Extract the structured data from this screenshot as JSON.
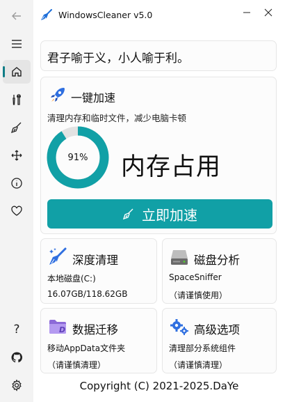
{
  "app": {
    "title": "WindowsCleaner v5.0",
    "accent": "#11a0a6"
  },
  "sidebar": {
    "top_items": [
      {
        "icon": "back-arrow-icon"
      },
      {
        "icon": "hamburger-menu-icon"
      }
    ],
    "items": [
      {
        "icon": "home-icon",
        "active": true
      },
      {
        "icon": "tools-icon"
      },
      {
        "icon": "broom-icon"
      },
      {
        "icon": "move-arrows-icon"
      },
      {
        "icon": "info-icon"
      },
      {
        "icon": "heart-icon"
      }
    ],
    "bottom_items": [
      {
        "icon": "help-icon",
        "label": "?"
      },
      {
        "icon": "github-icon"
      },
      {
        "icon": "settings-gear-icon"
      }
    ]
  },
  "window_controls": {
    "minimize": "minimize-icon",
    "close": "close-icon"
  },
  "quote": "君子喻于义，小人喻于利。",
  "boost": {
    "title": "一键加速",
    "description": "清理内存和临时文件，减少电脑卡顿",
    "memory_percent_value": 91,
    "memory_percent_text": "91%",
    "memory_label": "内存占用",
    "button_label": "立即加速",
    "ring_color": "#11a0a6",
    "ring_track": "#e2e2e2"
  },
  "tiles": [
    {
      "title": "深度清理",
      "line1": "本地磁盘(C:)",
      "line2": "16.07GB/118.62GB",
      "icon": "deep-clean-broom-icon"
    },
    {
      "title": "磁盘分析",
      "line1": "SpaceSniffer",
      "line2": "（请谨慎使用）",
      "icon": "hard-drive-icon"
    },
    {
      "title": "数据迁移",
      "line1": "移动AppData文件夹",
      "line2": "（请谨慎清理）",
      "icon": "folder-d-icon"
    },
    {
      "title": "高级选项",
      "line1": "清理部分系统组件",
      "line2": "（请谨慎清理）",
      "icon": "gears-icon"
    }
  ],
  "footer": "Copyright (C) 2021-2025.DaYe"
}
